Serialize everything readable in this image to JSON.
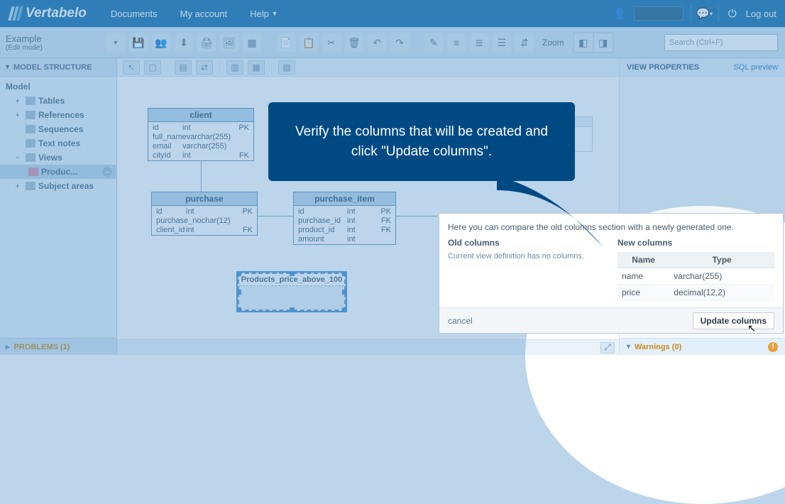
{
  "brand": "Vertabelo",
  "top_menu": [
    "Documents",
    "My account",
    "Help"
  ],
  "logout": "Log out",
  "workspace": {
    "name": "Example",
    "mode": "(Edit mode)",
    "zoom_label": "Zoom"
  },
  "search_placeholder": "Search (Ctrl+F)",
  "side_header": "MODEL STRUCTURE",
  "tree": {
    "root": "Model",
    "items": [
      "Tables",
      "References",
      "Sequences",
      "Text notes",
      "Views",
      "Subject areas"
    ],
    "view_child": "Produc..."
  },
  "problems": {
    "label": "PROBLEMS",
    "count": 1
  },
  "right_panel": {
    "title": "VIEW PROPERTIES",
    "sql": "SQL preview",
    "warnings_label": "Warnings",
    "warnings_count": 0
  },
  "erd": {
    "client": {
      "name": "client",
      "rows": [
        {
          "n": "id",
          "t": "int",
          "k": "PK"
        },
        {
          "n": "full_name",
          "t": "varchar(255)",
          "k": ""
        },
        {
          "n": "email",
          "t": "varchar(255)",
          "k": ""
        },
        {
          "n": "cityId",
          "t": "int",
          "k": "FK"
        }
      ]
    },
    "purchase": {
      "name": "purchase",
      "rows": [
        {
          "n": "id",
          "t": "int",
          "k": "PK"
        },
        {
          "n": "purchase_no",
          "t": "char(12)",
          "k": ""
        },
        {
          "n": "client_id",
          "t": "int",
          "k": "FK"
        }
      ]
    },
    "purchase_item": {
      "name": "purchase_item",
      "rows": [
        {
          "n": "id",
          "t": "int",
          "k": "PK"
        },
        {
          "n": "purchase_id",
          "t": "int",
          "k": "FK"
        },
        {
          "n": "product_id",
          "t": "int",
          "k": "FK"
        },
        {
          "n": "amount",
          "t": "int",
          "k": ""
        }
      ]
    },
    "view_name": "Products_price_above_100"
  },
  "compare": {
    "msg": "Here you can compare the old columns section with a newly generated one.",
    "old_title": "Old columns",
    "old_empty": "Current view definition has no columns.",
    "new_title": "New columns",
    "th_name": "Name",
    "th_type": "Type",
    "rows": [
      {
        "name": "name",
        "type": "varchar(255)"
      },
      {
        "name": "price",
        "type": "decimal(12,2)"
      }
    ],
    "cancel": "cancel",
    "update": "Update columns"
  },
  "callout": "Verify the columns that will be created and click \"Update columns\"."
}
